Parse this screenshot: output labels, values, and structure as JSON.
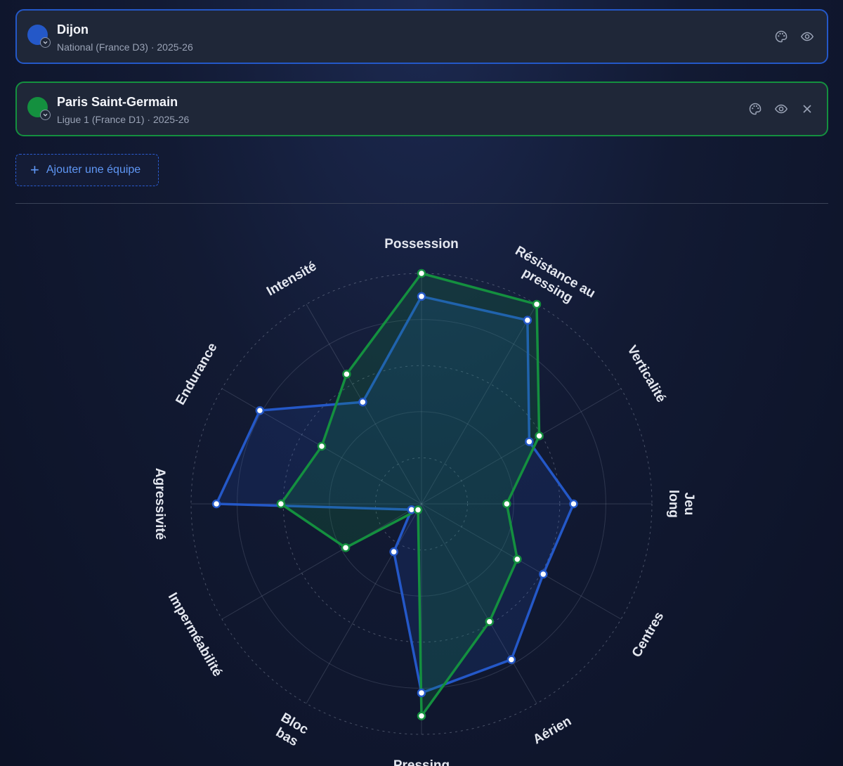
{
  "teams": [
    {
      "name": "Dijon",
      "subtitle": "National (France D3) · 2025-26",
      "color": "#2458c8"
    },
    {
      "name": "Paris Saint-Germain",
      "subtitle": "Ligue 1 (France D1) · 2025-26",
      "color": "#14903f"
    }
  ],
  "add_team_label": "Ajouter une équipe",
  "chart_data": {
    "type": "radar",
    "axes": [
      [
        "Possession"
      ],
      [
        "Résistance au",
        "pressing"
      ],
      [
        "Verticalité"
      ],
      [
        "Jeu",
        "long"
      ],
      [
        "Centres"
      ],
      [
        "Aérien"
      ],
      [
        "Pressing"
      ],
      [
        "Bloc",
        "bas"
      ],
      [
        "Imperméabilité"
      ],
      [
        "Agressivité"
      ],
      [
        "Endurance"
      ],
      [
        "Intensité"
      ]
    ],
    "rlim": [
      0,
      100
    ],
    "grid_rings": 5,
    "series": [
      {
        "name": "Dijon",
        "color": "#2458c8",
        "fill": "rgba(36,88,200,0.16)",
        "values": [
          90,
          92,
          54,
          66,
          61,
          78,
          82,
          24,
          5,
          89,
          81,
          51
        ]
      },
      {
        "name": "Paris Saint-Germain",
        "color": "#14903f",
        "fill": "rgba(20,144,63,0.20)",
        "values": [
          100,
          100,
          59,
          37,
          48,
          59,
          92,
          3,
          38,
          61,
          50,
          65
        ]
      }
    ]
  }
}
